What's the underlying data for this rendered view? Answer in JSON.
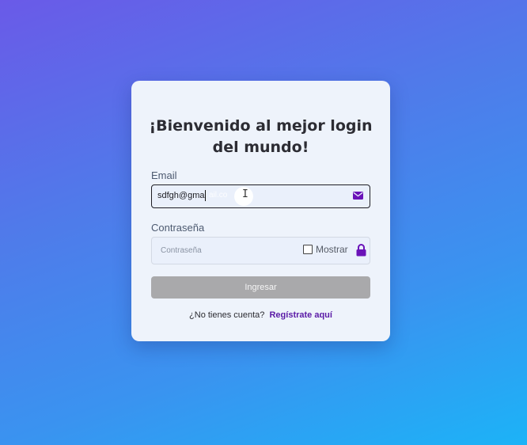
{
  "login": {
    "title": "¡Bienvenido al mejor login del mundo!",
    "email_label": "Email",
    "email_value": "sdfgh@gma",
    "password_label": "Contraseña",
    "password_placeholder": "Contraseña",
    "show_label": "Mostrar",
    "submit_label": "Ingresar",
    "register_prompt": "¿No tienes cuenta?",
    "register_link": "Regístrate aquí"
  },
  "icons": {
    "email": "envelope-icon",
    "password": "lock-icon"
  },
  "colors": {
    "accent": "#6a12b8",
    "disabled_button": "#a9a9ab"
  }
}
